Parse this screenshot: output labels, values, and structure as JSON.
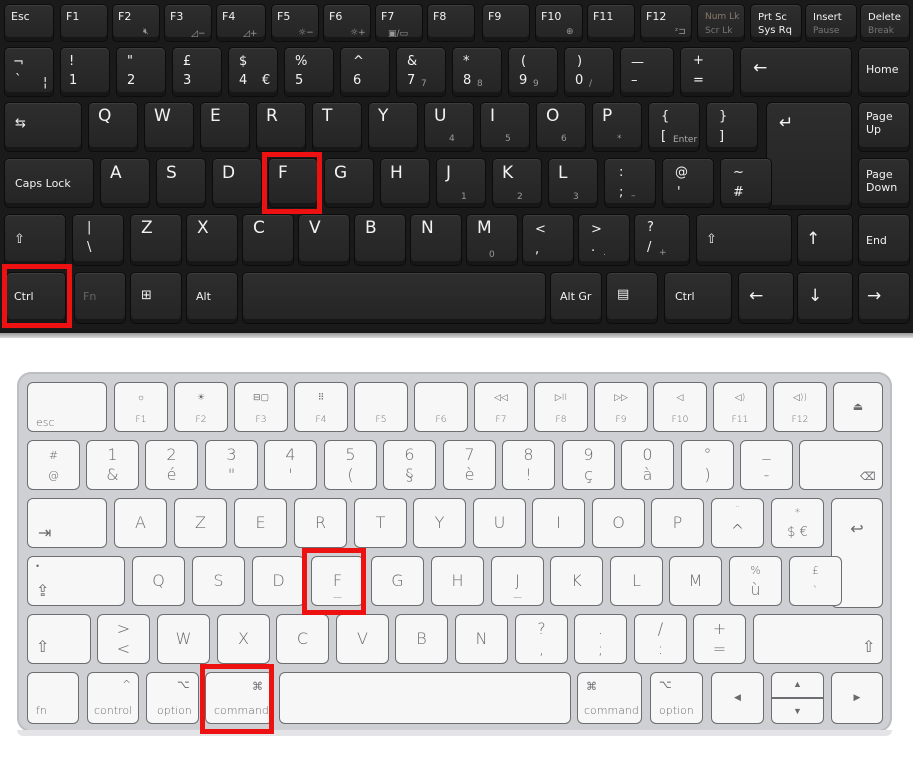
{
  "highlight_color": "#ee1111",
  "pc_keyboard": {
    "highlighted_keys": [
      "Ctrl",
      "F"
    ],
    "fn_row": {
      "esc": "Esc",
      "f1": "F1",
      "f2": "F2",
      "f3": "F3",
      "f4": "F4",
      "f5": "F5",
      "f6": "F6",
      "f7": "F7",
      "f8": "F8",
      "f9": "F9",
      "f10": "F10",
      "f11": "F11",
      "f12": "F12",
      "numlk": "Num Lk",
      "scrlk": "Scr Lk",
      "prtsc": "Prt Sc",
      "sysrq": "Sys Rq",
      "insert": "Insert",
      "pause": "Pause",
      "delete": "Delete",
      "break": "Break",
      "f2_icon": "mute-icon",
      "f3_icon": "volume-down-icon",
      "f4_icon": "volume-up-icon",
      "f5_icon": "brightness-down-icon",
      "f6_icon": "brightness-up-icon",
      "f7_icon": "display-switch-icon",
      "f10_icon": "zoom-icon",
      "f12_icon": "sleep-icon"
    },
    "number_row": [
      {
        "top": "¬",
        "bottom": "`",
        "alt": "¦"
      },
      {
        "top": "!",
        "bottom": "1"
      },
      {
        "top": "\"",
        "bottom": "2"
      },
      {
        "top": "£",
        "bottom": "3"
      },
      {
        "top": "$",
        "bottom": "4",
        "alt": "€"
      },
      {
        "top": "%",
        "bottom": "5"
      },
      {
        "top": "^",
        "bottom": "6"
      },
      {
        "top": "&",
        "bottom": "7",
        "alt": "7"
      },
      {
        "top": "*",
        "bottom": "8",
        "alt": "8"
      },
      {
        "top": "(",
        "bottom": "9",
        "alt": "9"
      },
      {
        "top": ")",
        "bottom": "0",
        "alt": "/"
      },
      {
        "top": "—",
        "bottom": "–"
      },
      {
        "top": "+",
        "bottom": "="
      }
    ],
    "backspace": "←",
    "home": "Home",
    "qwerty_row": [
      {
        "l": "Q"
      },
      {
        "l": "W"
      },
      {
        "l": "E"
      },
      {
        "l": "R"
      },
      {
        "l": "T"
      },
      {
        "l": "Y"
      },
      {
        "l": "U",
        "alt": "4"
      },
      {
        "l": "I",
        "alt": "5"
      },
      {
        "l": "O",
        "alt": "6"
      },
      {
        "l": "P",
        "alt": "*"
      }
    ],
    "bracket_left": {
      "top": "{",
      "bottom": "[",
      "alt": "Enter"
    },
    "bracket_right": {
      "top": "}",
      "bottom": "]"
    },
    "enter": "↵",
    "page_up": "Page Up",
    "caps_lock": "Caps Lock",
    "home_row": [
      {
        "l": "A"
      },
      {
        "l": "S"
      },
      {
        "l": "D"
      },
      {
        "l": "F"
      },
      {
        "l": "G"
      },
      {
        "l": "H"
      },
      {
        "l": "J",
        "alt": "1"
      },
      {
        "l": "K",
        "alt": "2"
      },
      {
        "l": "L",
        "alt": "3"
      }
    ],
    "semicolon": {
      "top": ":",
      "bottom": ";",
      "alt": "–"
    },
    "quote": {
      "top": "@",
      "bottom": "'"
    },
    "hash": {
      "top": "~",
      "bottom": "#"
    },
    "page_down": "Page Down",
    "shift": "⇧",
    "backslash": {
      "top": "|",
      "bottom": "\\"
    },
    "bottom_letters": [
      {
        "l": "Z"
      },
      {
        "l": "X"
      },
      {
        "l": "C"
      },
      {
        "l": "V"
      },
      {
        "l": "B"
      },
      {
        "l": "N"
      },
      {
        "l": "M",
        "alt": "0"
      }
    ],
    "comma": {
      "top": "<",
      "bottom": ","
    },
    "period": {
      "top": ">",
      "bottom": ".",
      "alt": "."
    },
    "slash": {
      "top": "?",
      "bottom": "/",
      "alt": "+"
    },
    "right_shift": "⇧",
    "arrow_up": "↑",
    "end": "End",
    "ctrl": "Ctrl",
    "fn": "Fn",
    "windows_icon": "windows-logo-icon",
    "alt": "Alt",
    "alt_gr": "Alt Gr",
    "menu_icon": "context-menu-icon",
    "right_ctrl": "Ctrl",
    "arrow_left": "←",
    "arrow_down": "↓",
    "arrow_right": "→"
  },
  "mac_keyboard": {
    "highlighted_keys": [
      "command",
      "F"
    ],
    "fn_row": {
      "esc": "esc",
      "keys": [
        {
          "label": "F1",
          "icon": "☼"
        },
        {
          "label": "F2",
          "icon": "☀"
        },
        {
          "label": "F3",
          "icon": "⊟▢"
        },
        {
          "label": "F4",
          "icon": "⠿"
        },
        {
          "label": "F5",
          "icon": ""
        },
        {
          "label": "F6",
          "icon": ""
        },
        {
          "label": "F7",
          "icon": "◁◁"
        },
        {
          "label": "F8",
          "icon": "▷II"
        },
        {
          "label": "F9",
          "icon": "▷▷"
        },
        {
          "label": "F10",
          "icon": "◁"
        },
        {
          "label": "F11",
          "icon": "◁)"
        },
        {
          "label": "F12",
          "icon": "◁))"
        }
      ],
      "eject": "⏏"
    },
    "number_row": [
      {
        "top": "#",
        "bottom": "@"
      },
      {
        "top": "1",
        "bottom": "&"
      },
      {
        "top": "2",
        "bottom": "é"
      },
      {
        "top": "3",
        "bottom": "\""
      },
      {
        "top": "4",
        "bottom": "'"
      },
      {
        "top": "5",
        "bottom": "("
      },
      {
        "top": "6",
        "bottom": "§"
      },
      {
        "top": "7",
        "bottom": "è"
      },
      {
        "top": "8",
        "bottom": "!"
      },
      {
        "top": "9",
        "bottom": "ç"
      },
      {
        "top": "0",
        "bottom": "à"
      },
      {
        "top": "°",
        "bottom": ")"
      },
      {
        "top": "_",
        "bottom": "-"
      }
    ],
    "delete": "⌫",
    "tab": "⇥",
    "azerty_row": [
      "A",
      "Z",
      "E",
      "R",
      "T",
      "Y",
      "U",
      "I",
      "O",
      "P"
    ],
    "circumflex": {
      "top": "¨",
      "bottom": "^"
    },
    "dollar": {
      "top": "*",
      "bottom": "$ €"
    },
    "return": "↩",
    "caps_lock": "⇪",
    "home_row": [
      "Q",
      "S",
      "D",
      "F",
      "G",
      "H",
      "J",
      "K",
      "L",
      "M"
    ],
    "percent": {
      "top": "%",
      "bottom": "ù"
    },
    "pound": {
      "top": "£",
      "bottom": "`"
    },
    "shift": "⇧",
    "angle": {
      "top": ">",
      "bottom": "<"
    },
    "bottom_letters": [
      "W",
      "X",
      "C",
      "V",
      "B",
      "N"
    ],
    "question": {
      "top": "?",
      "bottom": ","
    },
    "period": {
      "top": ".",
      "bottom": ";"
    },
    "slash": {
      "top": "/",
      "bottom": ":"
    },
    "plus": {
      "top": "+",
      "bottom": "="
    },
    "right_shift": "⇧",
    "fn": "fn",
    "control": "control",
    "control_symbol": "^",
    "option": "option",
    "option_symbol": "⌥",
    "command": "command",
    "command_symbol": "⌘",
    "arrow_left": "◀",
    "arrow_up": "▲",
    "arrow_down": "▼",
    "arrow_right": "▶"
  }
}
